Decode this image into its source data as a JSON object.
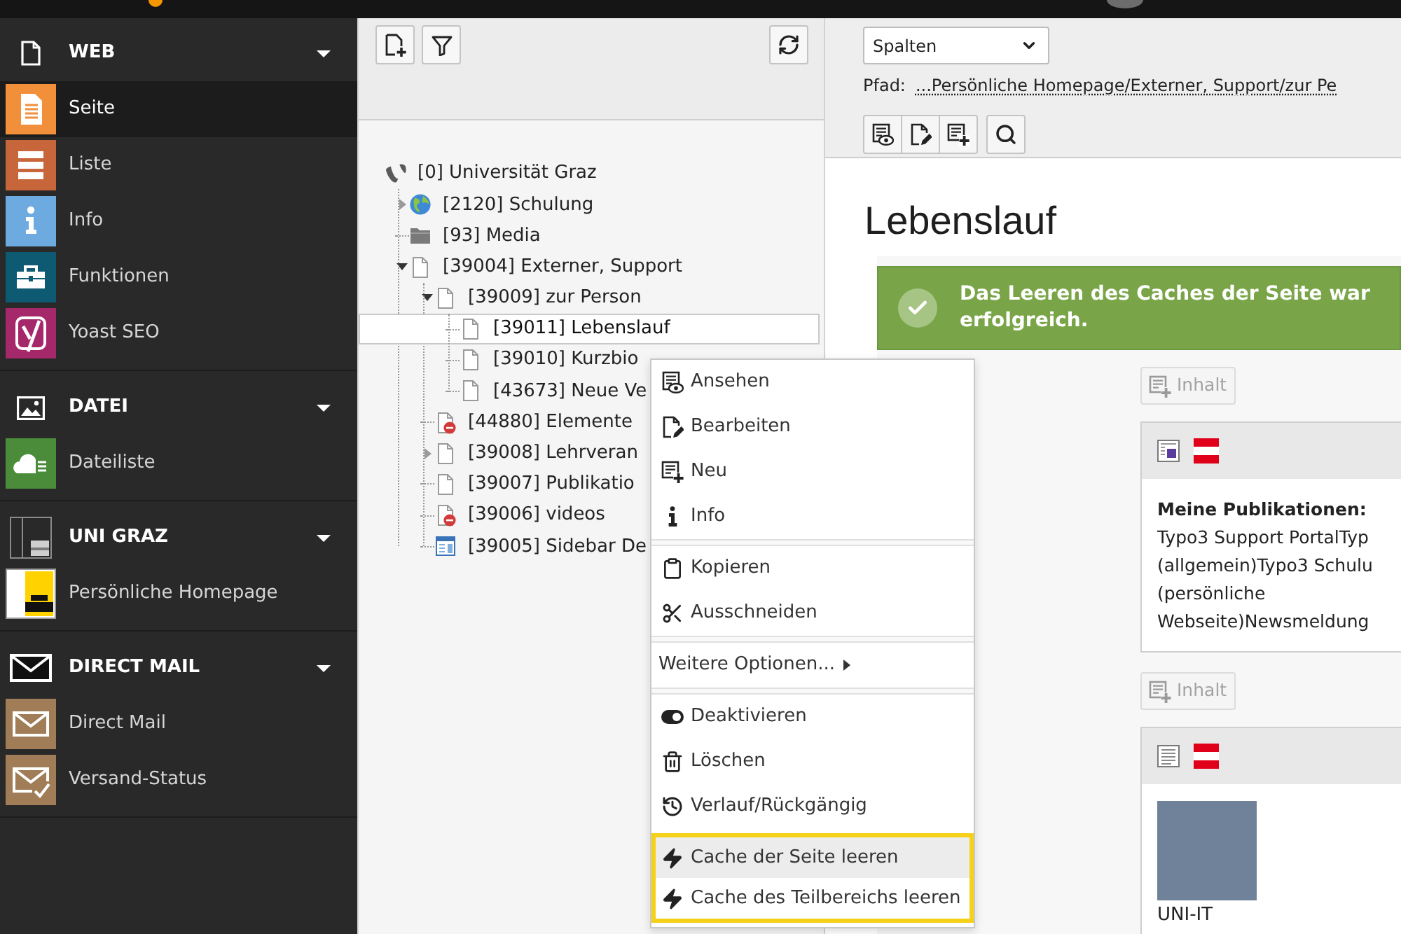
{
  "sidebar": {
    "groups": [
      {
        "label": "WEB",
        "expanded": true,
        "items": [
          {
            "label": "Seite",
            "selected": true
          },
          {
            "label": "Liste",
            "selected": false
          },
          {
            "label": "Info",
            "selected": false
          },
          {
            "label": "Funktionen",
            "selected": false
          },
          {
            "label": "Yoast SEO",
            "selected": false
          }
        ]
      },
      {
        "label": "DATEI",
        "expanded": true,
        "items": [
          {
            "label": "Dateiliste",
            "selected": false
          }
        ]
      },
      {
        "label": "UNI GRAZ",
        "expanded": true,
        "items": [
          {
            "label": "Persönliche Homepage",
            "selected": false
          }
        ]
      },
      {
        "label": "DIRECT MAIL",
        "expanded": true,
        "items": [
          {
            "label": "Direct Mail",
            "selected": false
          },
          {
            "label": "Versand-Status",
            "selected": false
          }
        ]
      }
    ]
  },
  "page_tree": {
    "nodes": [
      {
        "label": "[0] Universität Graz",
        "kind": "root",
        "selected": false,
        "disabled": false,
        "children": [
          {
            "label": "[2120] Schulung",
            "kind": "site",
            "selected": false,
            "disabled": false,
            "expanded": false
          },
          {
            "label": "[93] Media",
            "kind": "folder",
            "selected": false,
            "disabled": false
          },
          {
            "label": "[39004] Externer, Support",
            "kind": "page",
            "selected": false,
            "disabled": false,
            "expanded": true,
            "children": [
              {
                "label": "[39009] zur Person",
                "kind": "page",
                "selected": false,
                "disabled": false,
                "expanded": true,
                "children": [
                  {
                    "label": "[39011] Lebenslauf",
                    "kind": "page",
                    "selected": true,
                    "disabled": false
                  },
                  {
                    "label": "[39010] Kurzbio",
                    "kind": "page",
                    "selected": false,
                    "disabled": false
                  },
                  {
                    "label": "[43673] Neue Ve",
                    "kind": "page",
                    "selected": false,
                    "disabled": false
                  }
                ]
              },
              {
                "label": "[44880] Elemente",
                "kind": "page",
                "selected": false,
                "disabled": true
              },
              {
                "label": "[39008] Lehrveran",
                "kind": "page",
                "selected": false,
                "disabled": false,
                "expanded": false
              },
              {
                "label": "[39007] Publikatio",
                "kind": "page",
                "selected": false,
                "disabled": false
              },
              {
                "label": "[39006] videos",
                "kind": "page",
                "selected": false,
                "disabled": true
              },
              {
                "label": "[39005] Sidebar De",
                "kind": "sidebar",
                "selected": false,
                "disabled": false
              }
            ]
          }
        ]
      }
    ]
  },
  "doc_header": {
    "view_select": {
      "value": "Spalten"
    },
    "path": {
      "label": "Pfad:",
      "link": "...Persönliche Homepage/Externer, Support/zur Pe"
    }
  },
  "page": {
    "title": "Lebenslauf",
    "flash_message": {
      "text": "Das Leeren des Caches der Seite war erfolgreich."
    },
    "column": {
      "elements": [
        {
          "kind": "new_content",
          "label": "Inhalt"
        },
        {
          "kind": "plugin",
          "heading": "Meine Publikationen:",
          "lines": [
            "Typo3 Support PortalTyp",
            "(allgemein)Typo3 Schulu",
            "(persönliche",
            "Webseite)Newsmeldung"
          ]
        },
        {
          "kind": "new_content",
          "label": "Inhalt"
        },
        {
          "kind": "text_media",
          "caption": "UNI-IT"
        }
      ]
    }
  },
  "context_menu": {
    "groups": [
      {
        "items": [
          {
            "label": "Ansehen",
            "kind": "action",
            "selected": false,
            "framed": false
          },
          {
            "label": "Bearbeiten",
            "kind": "action",
            "selected": false,
            "framed": false
          },
          {
            "label": "Neu",
            "kind": "action",
            "selected": false,
            "framed": false
          },
          {
            "label": "Info",
            "kind": "action",
            "selected": false,
            "framed": false
          }
        ]
      },
      {
        "items": [
          {
            "label": "Kopieren",
            "kind": "action",
            "selected": false,
            "framed": false
          },
          {
            "label": "Ausschneiden",
            "kind": "action",
            "selected": false,
            "framed": false
          }
        ]
      },
      {
        "items": [
          {
            "label": "Weitere Optionen...",
            "kind": "submenu",
            "selected": false,
            "framed": false
          }
        ]
      },
      {
        "items": [
          {
            "label": "Deaktivieren",
            "kind": "action",
            "selected": false,
            "framed": false
          },
          {
            "label": "Löschen",
            "kind": "action",
            "selected": false,
            "framed": false
          },
          {
            "label": "Verlauf/Rückgängig",
            "kind": "action",
            "selected": false,
            "framed": false
          },
          {
            "label": "Cache der Seite leeren",
            "kind": "action",
            "selected": true,
            "framed": true
          },
          {
            "label": "Cache des Teilbereichs leeren",
            "kind": "action",
            "selected": false,
            "framed": true
          }
        ]
      }
    ]
  }
}
